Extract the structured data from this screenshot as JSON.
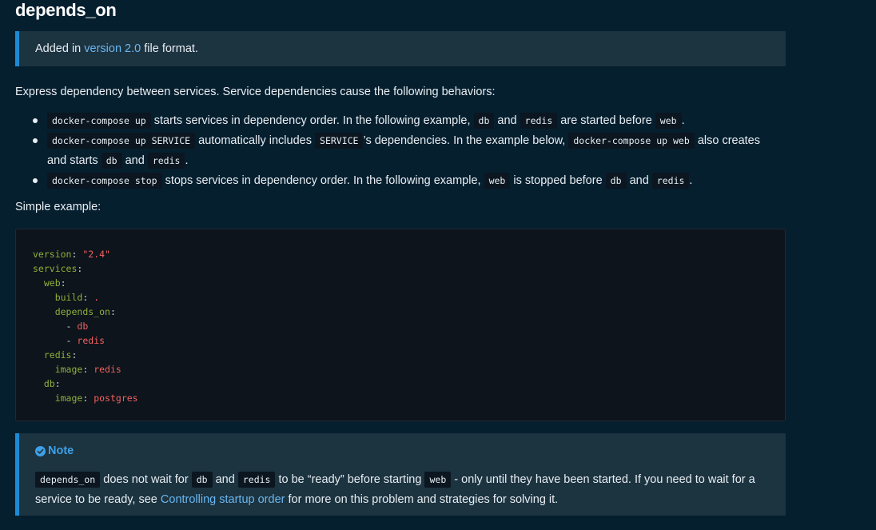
{
  "heading": "depends_on",
  "added_callout": {
    "prefix": "Added in",
    "link_text": "version 2.0",
    "suffix": "file format."
  },
  "intro": "Express dependency between services. Service dependencies cause the following behaviors:",
  "bullets": [
    {
      "code1": "docker-compose up",
      "t1": "starts services in dependency order. In the following example,",
      "code2": "db",
      "t2": "and",
      "code3": "redis",
      "t3": "are started before",
      "code4": "web",
      "t4": "."
    },
    {
      "code1": "docker-compose up SERVICE",
      "t1": "automatically includes",
      "code2": "SERVICE",
      "t2": "’s dependencies. In the example below,",
      "code3": "docker-compose up web",
      "t3": "also creates and starts",
      "code4": "db",
      "t4": "and",
      "code5": "redis",
      "t5": "."
    },
    {
      "code1": "docker-compose stop",
      "t1": "stops services in dependency order. In the following example,",
      "code2": "web",
      "t2": "is stopped before",
      "code3": "db",
      "t3": "and",
      "code4": "redis",
      "t4": "."
    }
  ],
  "simple_label": "Simple example:",
  "code_lines": {
    "l1_key": "version",
    "l1_colon": ":",
    "l1_val": "\"2.4\"",
    "l2_key": "services",
    "l2_colon": ":",
    "l3_key": "web",
    "l3_colon": ":",
    "l4_key": "build",
    "l4_colon": ":",
    "l4_val": ".",
    "l5_key": "depends_on",
    "l5_colon": ":",
    "l6_dash": "-",
    "l6_val": "db",
    "l7_dash": "-",
    "l7_val": "redis",
    "l8_key": "redis",
    "l8_colon": ":",
    "l9_key": "image",
    "l9_colon": ":",
    "l9_val": "redis",
    "l10_key": "db",
    "l10_colon": ":",
    "l11_key": "image",
    "l11_colon": ":",
    "l11_val": "postgres"
  },
  "note": {
    "title": "Note",
    "icon": "check-circle-icon",
    "code1": "depends_on",
    "t1": "does not wait for",
    "code2": "db",
    "t2": "and",
    "code3": "redis",
    "t3": "to be “ready” before starting",
    "code4": "web",
    "t4": "- only until they have been started. If you need to wait for a service to be ready, see",
    "link_text": "Controlling startup order",
    "t5": "for more on this problem and strategies for solving it."
  },
  "colors": {
    "background": "#061f2f",
    "callout_bg": "#1c3340",
    "accent": "#1d8ad6",
    "link": "#6ab7f0",
    "yaml_key": "#8fb03a",
    "yaml_value": "#f06060",
    "code_bg": "#0d141b"
  }
}
